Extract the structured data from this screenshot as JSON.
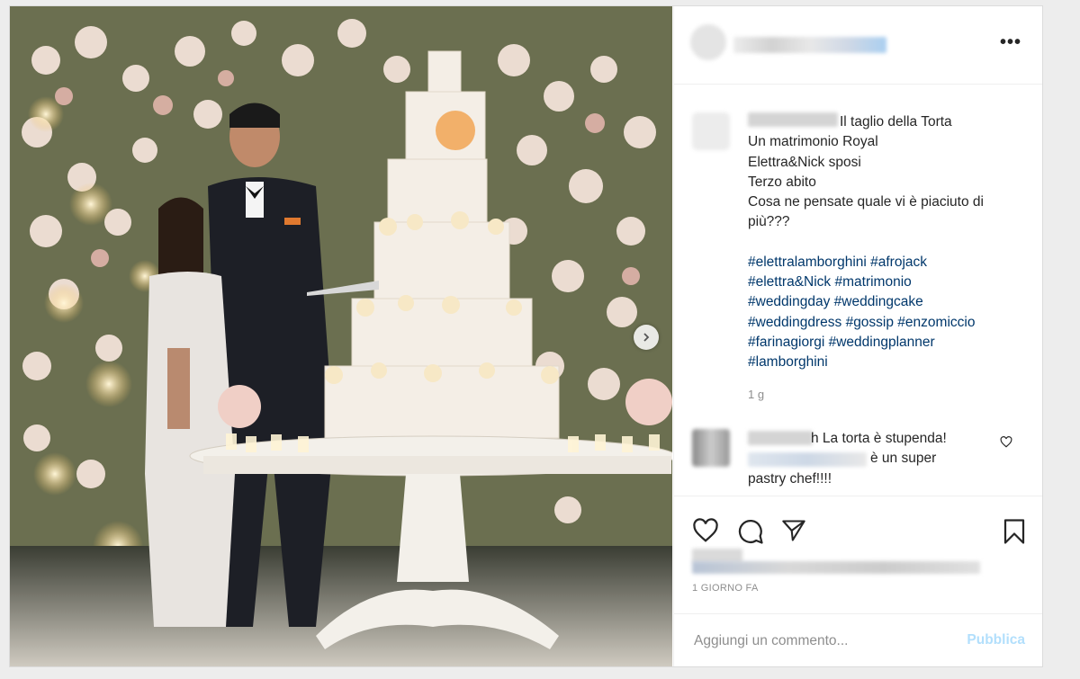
{
  "post": {
    "more_label": "•••",
    "caption": {
      "lines": [
        "Il taglio della Torta",
        "Un matrimonio Royal",
        "Elettra&Nick sposi",
        "Terzo abito",
        "Cosa ne pensate quale vi è piaciuto di",
        "più???"
      ],
      "hashtags": [
        "#elettralamborghini #afrojack",
        "#elettra&Nick #matrimonio",
        "#weddingday #weddingcake",
        "#weddingdress #gossip #enzomiccio",
        "#farinagiorgi #weddingplanner",
        "#lamborghini"
      ]
    },
    "caption_time": "1 g",
    "comment": {
      "line1": "h La torta è stupenda!",
      "line2": "è un super",
      "line3": "pastry chef!!!!"
    },
    "post_time": "1 GIORNO FA",
    "composer": {
      "placeholder": "Aggiungi un commento...",
      "publish_label": "Pubblica"
    },
    "colors": {
      "hashtag": "#00376b",
      "publish_disabled": "#b2dffc",
      "meta": "#8e8e8e"
    },
    "icons": [
      "heart-icon",
      "comment-icon",
      "share-icon",
      "bookmark-icon",
      "chevron-right-icon"
    ]
  }
}
